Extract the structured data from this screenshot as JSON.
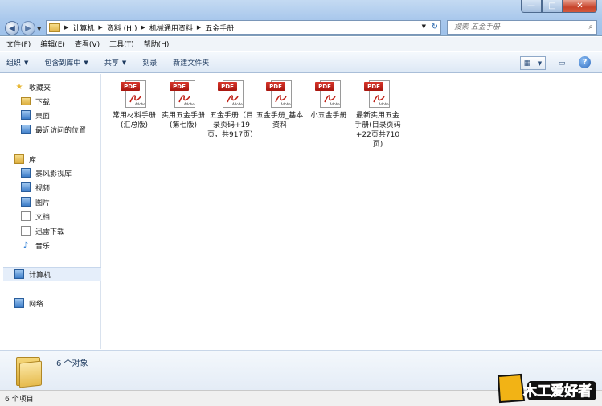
{
  "window": {
    "minimize_glyph": "—",
    "maximize_glyph": "□",
    "close_glyph": "✕"
  },
  "address": {
    "crumbs": [
      "计算机",
      "资料 (H:)",
      "机械通用资料",
      "五金手册"
    ]
  },
  "search": {
    "placeholder": "搜索 五金手册"
  },
  "menu": [
    "文件(F)",
    "编辑(E)",
    "查看(V)",
    "工具(T)",
    "帮助(H)"
  ],
  "toolbar": {
    "organize": "组织",
    "include_in_library": "包含到库中",
    "share": "共享",
    "burn": "刻录",
    "new_folder": "新建文件夹"
  },
  "nav": {
    "favorites": "收藏夹",
    "downloads": "下载",
    "desktop": "桌面",
    "recent": "最近访问的位置",
    "libraries": "库",
    "storm_video": "暴风影视库",
    "videos": "视频",
    "pictures": "图片",
    "documents": "文档",
    "thunder": "迅雷下载",
    "music": "音乐",
    "computer": "计算机",
    "network": "网络"
  },
  "files": [
    {
      "label": "常用材料手册(汇总版)",
      "badge": "PDF"
    },
    {
      "label": "实用五金手册 (第七版)",
      "badge": "PDF"
    },
    {
      "label": "五金手册（目录页码+19页，共917页）",
      "badge": "PDF"
    },
    {
      "label": "五金手册_基本资料",
      "badge": "PDF"
    },
    {
      "label": "小五金手册",
      "badge": "PDF"
    },
    {
      "label": "最新实用五金手册(目录页码+22页共710页)",
      "badge": "PDF"
    }
  ],
  "pdf_brand": "Adobe",
  "details": {
    "count": "6 个对象"
  },
  "status": {
    "items": "6 个项目"
  },
  "watermark_text": "木工爱好者",
  "colors": {
    "pdf_red": "#c0241a",
    "folder_yellow": "#e2b64a",
    "selection_blue": "#e5eefa"
  }
}
